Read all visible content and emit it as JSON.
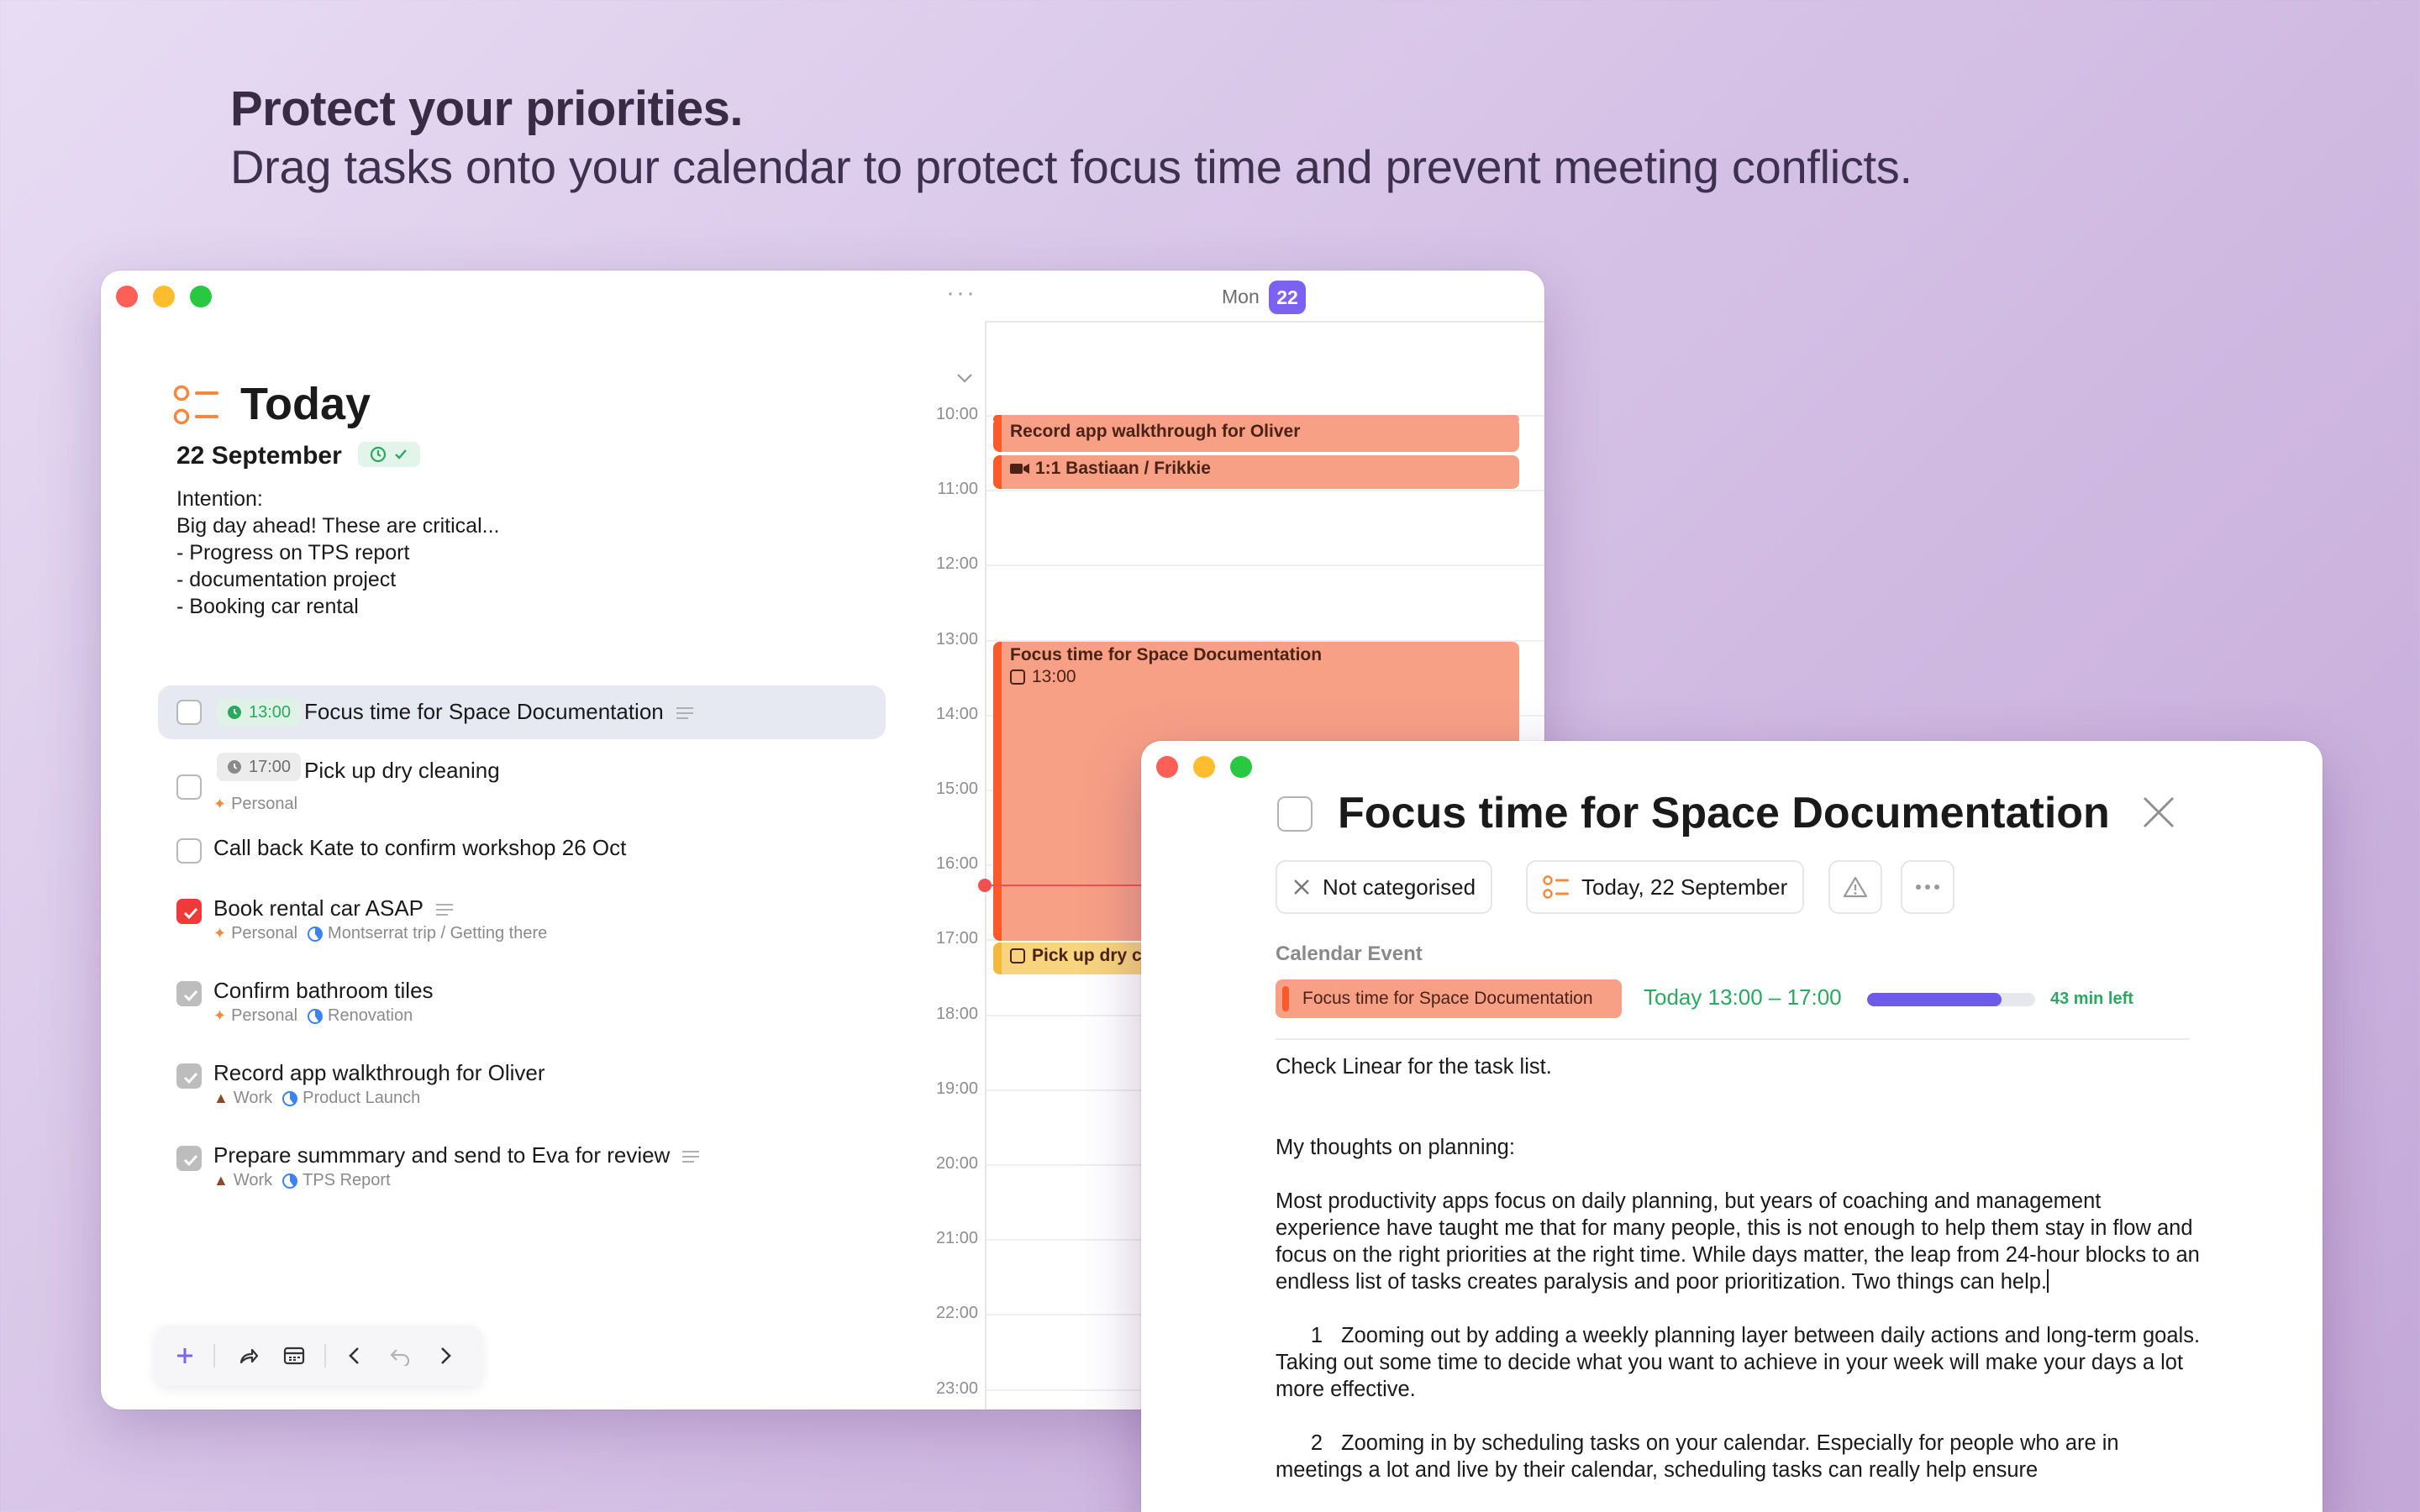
{
  "marketing": {
    "headline": "Protect your priorities.",
    "subline": "Drag tasks onto your calendar to protect focus time and prevent meeting conflicts."
  },
  "colors": {
    "accent_purple": "#7b62f0",
    "event_orange": "#f8a086",
    "event_orange_bar": "#fa5a2a",
    "event_yellow": "#f8d47e",
    "success_green": "#2aa860",
    "now_red": "#f05050"
  },
  "today": {
    "title": "Today",
    "date": "22 September",
    "intention_lines": [
      "Intention:",
      "Big day ahead! These are critical...",
      "- Progress on TPS report",
      "- documentation project",
      "- Booking car rental"
    ],
    "tasks": [
      {
        "title": "Focus time for Space Documentation",
        "time": "13:00",
        "time_style": "green",
        "meta": "",
        "checked": "none",
        "has_note": true
      },
      {
        "title": "Pick up dry cleaning",
        "time": "17:00",
        "time_style": "grey",
        "meta_area": "Personal",
        "meta_project": "",
        "checked": "none",
        "has_note": false
      },
      {
        "title": "Call back Kate to confirm workshop 26 Oct",
        "time": "",
        "checked": "none",
        "has_note": false
      },
      {
        "title": "Book rental car ASAP",
        "time": "",
        "meta_area": "Personal",
        "meta_project": "Montserrat trip / Getting there",
        "checked": "red",
        "has_note": true
      },
      {
        "title": "Confirm bathroom tiles",
        "time": "",
        "meta_area": "Personal",
        "meta_project": "Renovation",
        "checked": "grey",
        "has_note": false
      },
      {
        "title": "Record app walkthrough for Oliver",
        "time": "",
        "meta_area": "Work",
        "meta_project": "Product Launch",
        "checked": "grey",
        "has_note": false
      },
      {
        "title": "Prepare summmary and send to Eva for review",
        "time": "",
        "meta_area": "Work",
        "meta_project": "TPS Report",
        "checked": "grey",
        "has_note": true
      }
    ]
  },
  "calendar": {
    "more": "···",
    "day_label": "Mon",
    "day_number": "22",
    "hours": [
      "10:00",
      "11:00",
      "12:00",
      "13:00",
      "14:00",
      "15:00",
      "16:00",
      "17:00",
      "18:00",
      "19:00",
      "20:00",
      "21:00",
      "22:00",
      "23:00"
    ],
    "events": [
      {
        "title": "Record app walkthrough for Oliver",
        "color": "orange"
      },
      {
        "title": "1:1 Bastiaan / Frikkie",
        "color": "orange"
      },
      {
        "title": "Focus time for Space Documentation",
        "sub": "13:00",
        "color": "orange"
      },
      {
        "title": "Pick up dry c",
        "color": "yellow"
      }
    ]
  },
  "detail": {
    "title": "Focus time for Space Documentation",
    "category": "Not categorised",
    "date_chip": "Today, 22 September",
    "section_label": "Calendar Event",
    "event_name": "Focus time for Space Documentation",
    "event_time": "Today 13:00 – 17:00",
    "progress_fraction": 0.8,
    "time_left": "43 min left",
    "notes": {
      "line1": "Check Linear for the task list.",
      "heading": "My thoughts on planning:",
      "para": "Most productivity apps focus on daily planning, but years of coaching and management experience have taught me that for many people, this is not enough to help them stay in flow and focus on the right priorities at the right time. While days matter, the leap from 24-hour blocks to an endless list of tasks creates paralysis and poor prioritization. Two things can help.",
      "item1_num": "1",
      "item1": "Zooming out by adding a weekly planning layer between daily actions and long-term goals. Taking out some time to decide what you want to achieve in your week will make your days a lot more effective.",
      "item2_num": "2",
      "item2": "Zooming in by scheduling tasks on your calendar. Especially for people who are in meetings a lot and live by their calendar, scheduling tasks can really help ensure"
    }
  }
}
